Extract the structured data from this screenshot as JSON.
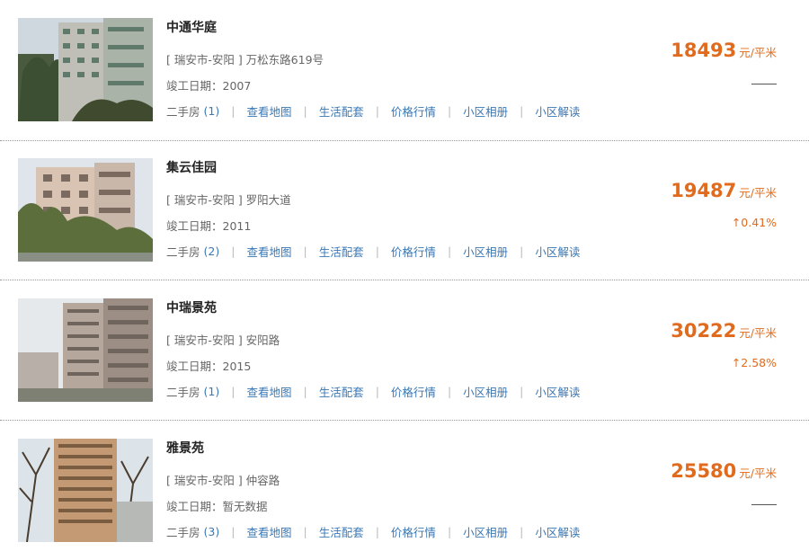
{
  "listings": [
    {
      "name": "中通华庭",
      "address": "[ 瑞安市-安阳 ] 万松东路619号",
      "year": "竣工日期：2007",
      "resale_label": "二手房",
      "resale_count": "(1)",
      "price": "18493",
      "unit": "元/平米",
      "change": ""
    },
    {
      "name": "集云佳园",
      "address": "[ 瑞安市-安阳 ] 罗阳大道",
      "year": "竣工日期：2011",
      "resale_label": "二手房",
      "resale_count": "(2)",
      "price": "19487",
      "unit": "元/平米",
      "change": "↑0.41%"
    },
    {
      "name": "中瑞景苑",
      "address": "[ 瑞安市-安阳 ] 安阳路",
      "year": "竣工日期：2015",
      "resale_label": "二手房",
      "resale_count": "(1)",
      "price": "30222",
      "unit": "元/平米",
      "change": "↑2.58%"
    },
    {
      "name": "雅景苑",
      "address": "[ 瑞安市-安阳 ] 仲容路",
      "year": "竣工日期：暂无数据",
      "resale_label": "二手房",
      "resale_count": "(3)",
      "price": "25580",
      "unit": "元/平米",
      "change": ""
    }
  ],
  "links": [
    "查看地图",
    "生活配套",
    "价格行情",
    "小区相册",
    "小区解读"
  ],
  "colors": {
    "price": "#e06b1e",
    "link": "#3a78b5",
    "text": "#666666"
  }
}
